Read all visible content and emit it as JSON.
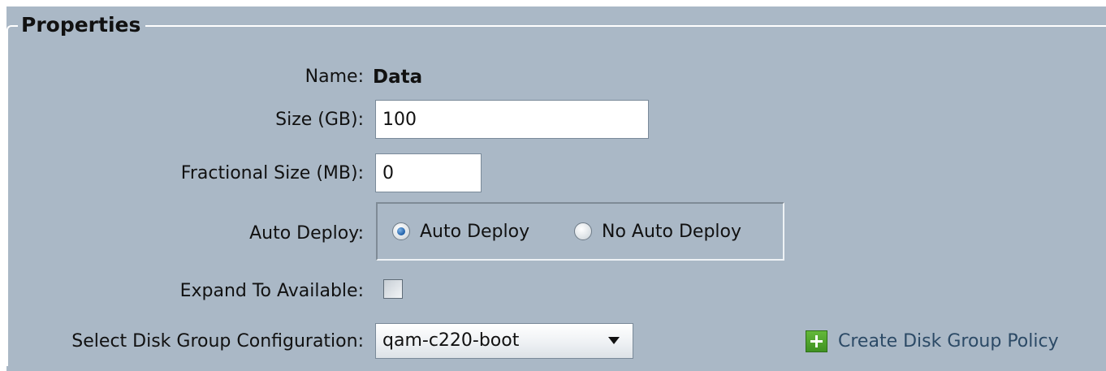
{
  "section": {
    "title": "Properties"
  },
  "fields": {
    "name": {
      "label": "Name:",
      "value": "Data"
    },
    "size_gb": {
      "label": "Size (GB):",
      "value": "100"
    },
    "fractional_size_mb": {
      "label": "Fractional Size (MB):",
      "value": "0"
    },
    "auto_deploy": {
      "label": "Auto Deploy:",
      "options": [
        {
          "label": "Auto Deploy",
          "checked": true
        },
        {
          "label": "No Auto Deploy",
          "checked": false
        }
      ]
    },
    "expand_to_available": {
      "label": "Expand To Available:",
      "checked": false
    },
    "disk_group_configuration": {
      "label": "Select Disk Group Configuration:",
      "selected": "qam-c220-boot"
    }
  },
  "actions": {
    "create_disk_group_policy": {
      "label": "Create Disk Group Policy",
      "icon": "plus-icon"
    }
  },
  "colors": {
    "panel_background": "#aab8c6",
    "link_text": "#2c4a66",
    "plus_icon": "#4fa12b"
  }
}
